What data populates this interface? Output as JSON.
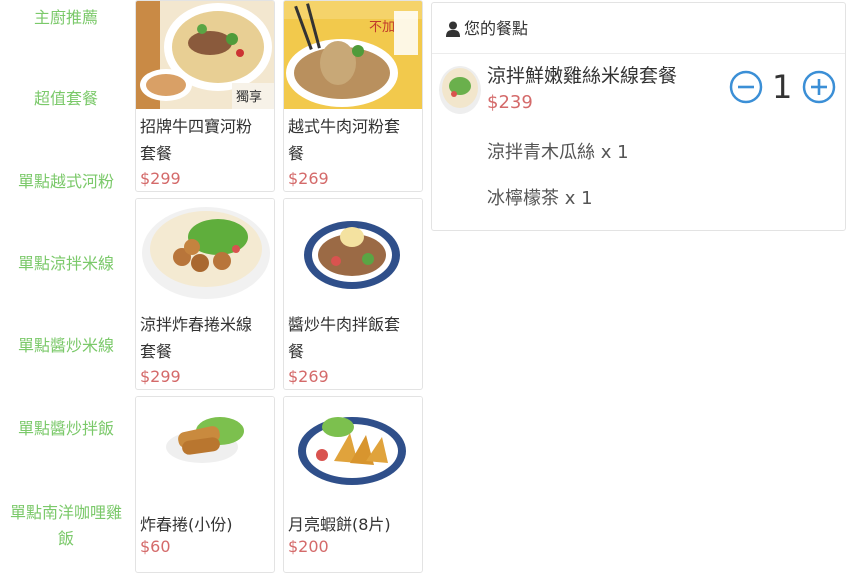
{
  "sidebar": {
    "categories": [
      "主廚推薦",
      "超值套餐",
      "單點越式河粉",
      "單點涼拌米線",
      "單點醬炒米線",
      "單點醬炒拌飯",
      "單點南洋咖哩雞",
      "飯"
    ]
  },
  "products": [
    {
      "name_line1": "招牌牛四寶河粉",
      "name_line2": "套餐",
      "price": "$299",
      "image": "beef-pho-bowl-image",
      "image_text": "獨享"
    },
    {
      "name_line1": "越式牛肉河粉套",
      "name_line2": "餐",
      "price": "$269",
      "image": "beef-pho-poster-image",
      "image_text": "不加"
    },
    {
      "name_line1": "涼拌炸春捲米線",
      "name_line2": "套餐",
      "price": "$299",
      "image": "spring-roll-vermicelli-image"
    },
    {
      "name_line1": "醬炒牛肉拌飯套",
      "name_line2": "餐",
      "price": "$269",
      "image": "beef-rice-plate-image"
    },
    {
      "name_line1": "炸春捲(小份)",
      "name_line2": "",
      "price": "$60",
      "image": "fried-spring-roll-image"
    },
    {
      "name_line1": "月亮蝦餅(8片)",
      "name_line2": "",
      "price": "$200",
      "image": "shrimp-cake-image"
    }
  ],
  "order": {
    "title": "您的餐點",
    "title_icon": "user-icon",
    "item_name": "涼拌鮮嫩雞絲米線套餐",
    "item_price": "$239",
    "quantity": "1",
    "addons": [
      "涼拌青木瓜絲 x 1",
      "冰檸檬茶 x 1"
    ],
    "minus_icon": "minus-circle-icon",
    "plus_icon": "plus-circle-icon"
  },
  "colors": {
    "category": "#7bc96a",
    "price": "#d46a6a",
    "accent_blue": "#3b8fd6"
  }
}
